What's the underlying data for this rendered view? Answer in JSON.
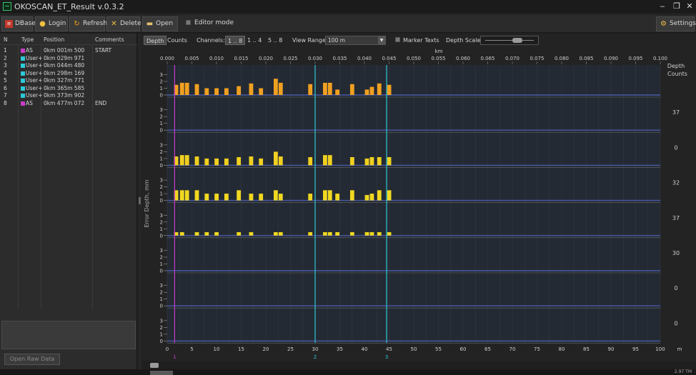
{
  "window": {
    "title": "OKOSCAN_ET_Result v.0.3.2",
    "minimize": "‒",
    "restore": "❐",
    "close": "✕"
  },
  "toolbar": {
    "dbase": "DBase",
    "login": "Login",
    "refresh": "Refresh",
    "delete": "Delete",
    "open": "Open",
    "editor_mode": "Editor mode",
    "settings": "Settings"
  },
  "markers_table": {
    "headers": [
      "N",
      "Type",
      "Position",
      "Comments"
    ],
    "rows": [
      {
        "n": "1",
        "type": "AS",
        "color": "#c83cc8",
        "position": "0km 001m 500",
        "comment": "START"
      },
      {
        "n": "2",
        "type": "User+",
        "color": "#2ec8d8",
        "position": "0km 029m 971",
        "comment": ""
      },
      {
        "n": "3",
        "type": "User+",
        "color": "#2ec8d8",
        "position": "0km 044m 480",
        "comment": ""
      },
      {
        "n": "4",
        "type": "User+",
        "color": "#2ec8d8",
        "position": "0km 298m 169",
        "comment": ""
      },
      {
        "n": "5",
        "type": "User+",
        "color": "#2ec8d8",
        "position": "0km 327m 771",
        "comment": ""
      },
      {
        "n": "6",
        "type": "User+",
        "color": "#2ec8d8",
        "position": "0km 365m 585",
        "comment": ""
      },
      {
        "n": "7",
        "type": "User+",
        "color": "#2ec8d8",
        "position": "0km 373m 902",
        "comment": ""
      },
      {
        "n": "8",
        "type": "AS",
        "color": "#c83cc8",
        "position": "0km 477m 072",
        "comment": "END"
      }
    ],
    "open_raw_label": "Open Raw Data"
  },
  "chart_controls": {
    "tab_depth": "Depth",
    "tab_counts": "Counts",
    "channels_label": "Channels:",
    "channel_opts": [
      "1 .. 8",
      "1 .. 4",
      "5 .. 8"
    ],
    "view_range_label": "View Range:",
    "view_range_value": "100 m",
    "marker_texts_label": "Marker Texts",
    "depth_scale_label": "Depth Scale:"
  },
  "status": {
    "right_text": "2.97 TM"
  },
  "chart_data": {
    "type": "bar",
    "ylabel": "Error Depth, mm",
    "right_header": [
      "Depth",
      "Counts"
    ],
    "x_top_unit": "km",
    "x_bottom_unit": "m",
    "x_top_ticks": [
      "0.000",
      "0.005",
      "0.010",
      "0.015",
      "0.020",
      "0.025",
      "0.030",
      "0.035",
      "0.040",
      "0.045",
      "0.050",
      "0.055",
      "0.060",
      "0.065",
      "0.070",
      "0.075",
      "0.080",
      "0.085",
      "0.090",
      "0.095",
      "0.100"
    ],
    "x_bottom_ticks": [
      "0",
      "5",
      "10",
      "15",
      "20",
      "25",
      "30",
      "35",
      "40",
      "45",
      "50",
      "55",
      "60",
      "65",
      "70",
      "75",
      "80",
      "85",
      "90",
      "95",
      "100"
    ],
    "xlim": [
      0,
      100
    ],
    "ylim": [
      0,
      3
    ],
    "y_ticks": [
      "0",
      "1",
      "2",
      "3"
    ],
    "markers": [
      {
        "x": 1.5,
        "label": "1",
        "color": "#c83cc8"
      },
      {
        "x": 30.0,
        "label": "2",
        "color": "#2ec8d8"
      },
      {
        "x": 44.5,
        "label": "3",
        "color": "#2ec8d8"
      }
    ],
    "channels": [
      {
        "count": "",
        "color": "#f0a020",
        "bars": [
          [
            1.8,
            1.5
          ],
          [
            3.0,
            1.8
          ],
          [
            4.0,
            1.8
          ],
          [
            6.0,
            1.6
          ],
          [
            8.0,
            1.0
          ],
          [
            10.0,
            1.0
          ],
          [
            12.0,
            1.0
          ],
          [
            14.5,
            1.3
          ],
          [
            17.0,
            1.7
          ],
          [
            19.0,
            1.0
          ],
          [
            22.0,
            2.4
          ],
          [
            23.0,
            1.8
          ],
          [
            29.0,
            1.6
          ],
          [
            32.0,
            1.8
          ],
          [
            33.0,
            1.8
          ],
          [
            34.5,
            0.8
          ],
          [
            37.5,
            1.6
          ],
          [
            40.5,
            0.8
          ],
          [
            41.5,
            1.2
          ],
          [
            43.0,
            1.7
          ],
          [
            45.0,
            1.5
          ]
        ]
      },
      {
        "count": "37",
        "color": "#f0a020",
        "bars": []
      },
      {
        "count": "0",
        "color": "#f0d020",
        "bars": [
          [
            1.8,
            1.3
          ],
          [
            3.0,
            1.5
          ],
          [
            4.0,
            1.5
          ],
          [
            6.0,
            1.3
          ],
          [
            8.0,
            1.0
          ],
          [
            10.0,
            1.0
          ],
          [
            12.0,
            1.0
          ],
          [
            14.5,
            1.2
          ],
          [
            17.0,
            1.3
          ],
          [
            19.0,
            1.0
          ],
          [
            22.0,
            2.0
          ],
          [
            23.0,
            1.3
          ],
          [
            29.0,
            1.2
          ],
          [
            32.0,
            1.5
          ],
          [
            33.0,
            1.5
          ],
          [
            37.5,
            1.2
          ],
          [
            40.5,
            1.0
          ],
          [
            41.5,
            1.2
          ],
          [
            43.0,
            1.2
          ],
          [
            45.0,
            1.2
          ]
        ]
      },
      {
        "count": "32",
        "color": "#f0d820",
        "bars": [
          [
            1.8,
            1.5
          ],
          [
            3.0,
            1.5
          ],
          [
            4.0,
            1.5
          ],
          [
            6.0,
            1.5
          ],
          [
            8.0,
            1.0
          ],
          [
            10.0,
            1.0
          ],
          [
            12.0,
            1.0
          ],
          [
            14.5,
            1.5
          ],
          [
            17.0,
            1.0
          ],
          [
            19.0,
            1.0
          ],
          [
            22.0,
            1.5
          ],
          [
            23.0,
            1.0
          ],
          [
            29.0,
            1.0
          ],
          [
            32.0,
            1.5
          ],
          [
            33.0,
            1.5
          ],
          [
            34.5,
            1.0
          ],
          [
            37.5,
            1.5
          ],
          [
            40.5,
            0.8
          ],
          [
            41.5,
            1.0
          ],
          [
            43.0,
            1.5
          ],
          [
            45.0,
            1.5
          ]
        ]
      },
      {
        "count": "37",
        "color": "#f0d820",
        "bars": [
          [
            1.8,
            0.5
          ],
          [
            3.0,
            0.5
          ],
          [
            6.0,
            0.5
          ],
          [
            8.0,
            0.5
          ],
          [
            10.0,
            0.5
          ],
          [
            14.5,
            0.5
          ],
          [
            17.0,
            0.5
          ],
          [
            22.0,
            0.5
          ],
          [
            23.0,
            0.5
          ],
          [
            29.0,
            0.5
          ],
          [
            32.0,
            0.5
          ],
          [
            33.0,
            0.5
          ],
          [
            34.5,
            0.5
          ],
          [
            37.5,
            0.5
          ],
          [
            40.5,
            0.5
          ],
          [
            41.5,
            0.5
          ],
          [
            43.0,
            0.5
          ],
          [
            45.0,
            0.5
          ]
        ]
      },
      {
        "count": "30",
        "color": "#f0d820",
        "bars": []
      },
      {
        "count": "0",
        "color": "#f0d820",
        "bars": []
      },
      {
        "count": "0",
        "color": "#f0d820",
        "bars": []
      }
    ]
  }
}
